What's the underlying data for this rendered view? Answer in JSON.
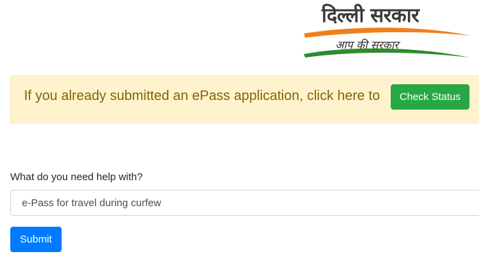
{
  "logo": {
    "title": "दिल्ली सरकार",
    "tagline": "आप की सरकार",
    "colors": {
      "saffron": "#f07f1a",
      "green": "#2e8b2e",
      "text": "#3a3a3a"
    }
  },
  "alert": {
    "message": "If you already submitted an ePass application, click here to",
    "button_label": "Check Status",
    "background": "#fff3cd",
    "text_color": "#856404",
    "button_color": "#28a745"
  },
  "form": {
    "help_label": "What do you need help with?",
    "help_selected": "e-Pass for travel during curfew",
    "submit_label": "Submit",
    "submit_color": "#007bff"
  }
}
